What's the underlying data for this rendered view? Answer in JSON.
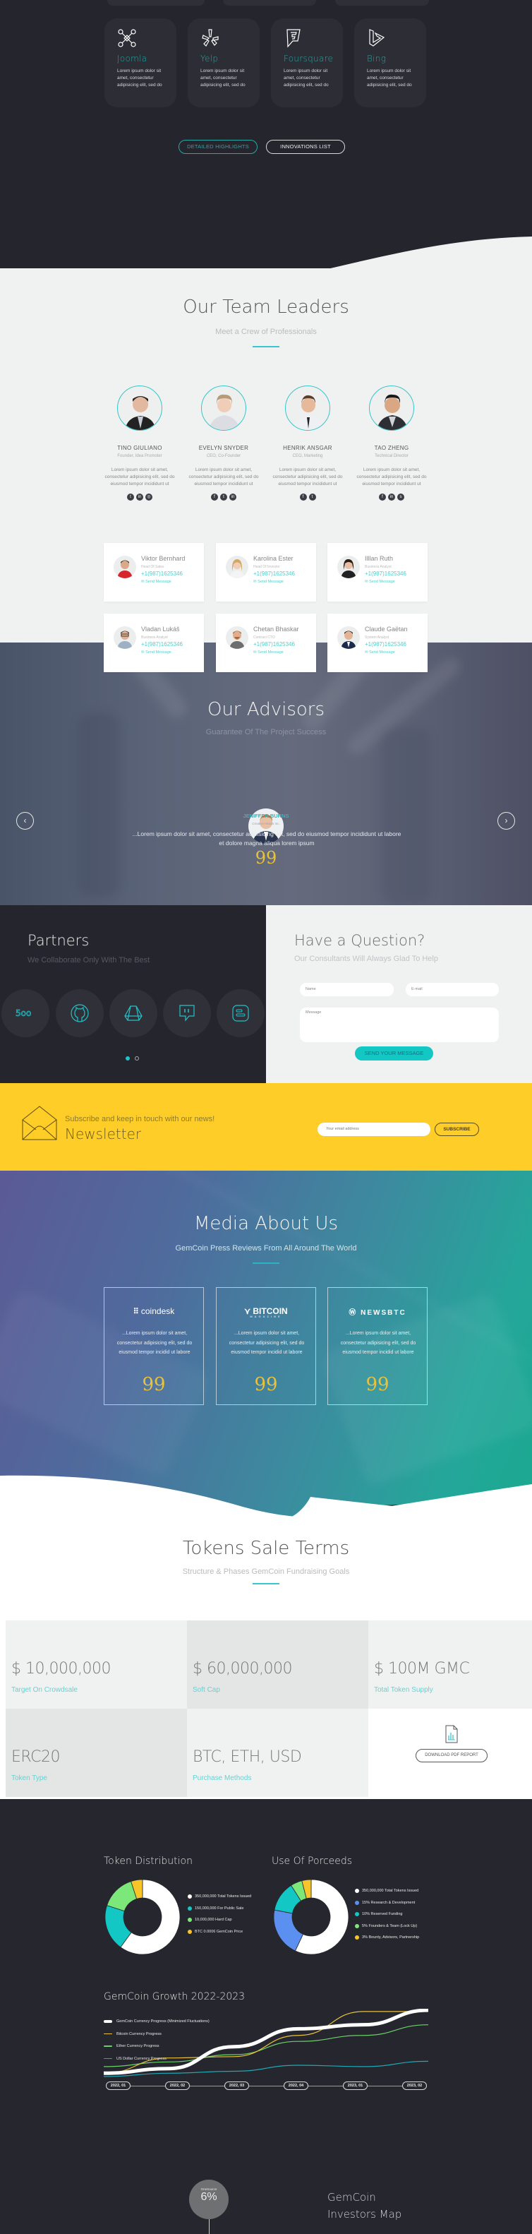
{
  "features": {
    "cards": [
      {
        "icon": "joomla-icon",
        "title": "Joomla",
        "text": "Lorem ipsum dolor sit amet, consectetur adipisicing elit, sed do"
      },
      {
        "icon": "yelp-icon",
        "title": "Yelp",
        "text": "Lorem ipsum dolor sit amet, consectetur adipisicing elit, sed do"
      },
      {
        "icon": "foursquare-icon",
        "title": "Foursquare",
        "text": "Lorem ipsum dolor sit amet, consectetur adipisicing elit, sed do"
      },
      {
        "icon": "bing-icon",
        "title": "Bing",
        "text": "Lorem ipsum dolor sit amet, consectetur adipisicing elit, sed do"
      }
    ],
    "buttons": {
      "highlights": "DETAILED HIGHLIGHTS",
      "innovations": "INNOVATIONS LIST"
    }
  },
  "team": {
    "title": "Our Team Leaders",
    "subtitle": "Meet a Crew of Professionals",
    "leaders": [
      {
        "name": "TINO GIULIANO",
        "role": "Founder, Idea Promoter",
        "desc": "Lorem ipsum dolor sit amet, consectetur adipisicing elit, sed do eiusmod tempor incididunt ut",
        "socials": [
          "twitter-icon",
          "linkedin-icon",
          "instagram-icon"
        ]
      },
      {
        "name": "EVELYN SNYDER",
        "role": "CEO, Co-Founder",
        "desc": "Lorem ipsum dolor sit amet, consectetur adipisicing elit, sed do eiusmod tempor incididunt ut",
        "socials": [
          "facebook-icon",
          "twitter-icon",
          "linkedin-icon"
        ]
      },
      {
        "name": "HENRIK ANSGAR",
        "role": "CEO, Marketing",
        "desc": "Lorem ipsum dolor sit amet, consectetur adipisicing elit, sed do eiusmod tempor incididunt ut",
        "socials": [
          "facebook-icon",
          "twitter-icon"
        ]
      },
      {
        "name": "TAO ZHENG",
        "role": "Technical Director",
        "desc": "Lorem ipsum dolor sit amet, consectetur adipisicing elit, sed do eiusmod tempor incididunt ut",
        "socials": [
          "facebook-icon",
          "linkedin-icon",
          "skype-icon"
        ]
      }
    ],
    "members": [
      {
        "name": "Viktor Bernhard",
        "role": "Head Of Sales",
        "phone": "+1(987)1625346",
        "action": "Send Message"
      },
      {
        "name": "Karolina Ester",
        "role": "Head Of Investor",
        "phone": "+1(987)1625346",
        "action": "Send Message"
      },
      {
        "name": "Illlan Ruth",
        "role": "Business Analyst",
        "phone": "+1(987)1625346",
        "action": "Send Message"
      },
      {
        "name": "Vladan Lukáš",
        "role": "Business Analyst",
        "phone": "+1(987)1625346",
        "action": "Send Message"
      },
      {
        "name": "Chetan Bhaskar",
        "role": "Contract CTO",
        "phone": "+1(987)1625346",
        "action": "Send Message"
      },
      {
        "name": "Claude Gaëtan",
        "role": "System Analyst",
        "phone": "+1(987)1625346",
        "action": "Send Message"
      }
    ]
  },
  "advisors": {
    "title": "Our Advisors",
    "subtitle": "Guarantee Of The Project Success",
    "name": "JENIFFER BURNS",
    "company": "Creative Heads Inc.",
    "quote": "...Lorem ipsum dolor sit amet, consectetur adipisicing elit, sed do eiusmod tempor incididunt ut labore et dolore magna aliqua lorem ipsum",
    "quote_mark": "99"
  },
  "partners": {
    "title": "Partners",
    "subtitle": "We Collaborate Only With The Best",
    "logos": [
      "500px-icon",
      "github-icon",
      "google-drive-icon",
      "twitch-icon",
      "blogger-icon"
    ],
    "active_page": 1,
    "pages": 2
  },
  "question": {
    "title": "Have a Question?",
    "subtitle": "Our Consultants Will Always Glad To Help",
    "name_placeholder": "Name",
    "email_placeholder": "E-mail",
    "message_placeholder": "Message",
    "submit": "SEND YOUR MESSAGE"
  },
  "newsletter": {
    "tagline": "Subscribe and keep in touch with our news!",
    "title": "Newsletter",
    "email_placeholder": "Your email address",
    "button": "SUBSCRIBE"
  },
  "media": {
    "title": "Media About Us",
    "subtitle": "GemCoin Press Reviews From All Around The World",
    "cards": [
      {
        "logo": "coindesk",
        "text": "...Lorem ipsum dolor sit amet, consectetur adipisicing elit, sed do eiusmod tempor incidid ut labore"
      },
      {
        "logo": "BITCOIN",
        "logo_sub": "MAGAZINE",
        "text": "...Lorem ipsum dolor sit amet, consectetur adipisicing elit, sed do eiusmod tempor incidid ut labore"
      },
      {
        "logo": "NEWSBTC",
        "text": "...Lorem ipsum dolor sit amet, consectetur adipisicing elit, sed do eiusmod tempor incidid ut labore"
      }
    ],
    "quote_mark": "99"
  },
  "tokens": {
    "title": "Tokens Sale Terms",
    "subtitle": "Structure & Phases GemCoin Fundraising Goals",
    "cells": [
      {
        "value": "$ 10,000,000",
        "label": "Target On Crowdsale"
      },
      {
        "value": "$ 60,000,000",
        "label": "Soft Cap"
      },
      {
        "value": "$ 100M GMC",
        "label": "Total Token Supply"
      },
      {
        "value": "ERC20",
        "label": "Token Type"
      },
      {
        "value": "BTC, ETH, USD",
        "label": "Purchase Methods"
      }
    ],
    "download": "DOWNLOAD PDF REPORT"
  },
  "colors": {
    "accent": "#3bc5cf",
    "dark": "#26272e",
    "yellow": "#fecd27",
    "white": "#ffffff",
    "cyan": "#13c7c4",
    "green": "#7de87a",
    "gold": "#f7c52a",
    "blue": "#5b8ff0"
  },
  "chart_data": [
    {
      "type": "pie",
      "title": "Token Distribution",
      "labels": [
        "350,000,000 Total Tokens Issued",
        "150,000,000 For Public Sale",
        "10,000,000 Hard Cap",
        "BTC 0.0006 GemCoin Price"
      ],
      "values": [
        60,
        20,
        15,
        5
      ],
      "colors": [
        "#ffffff",
        "#13c7c4",
        "#7de87a",
        "#f7c52a"
      ],
      "legend": "right"
    },
    {
      "type": "pie",
      "title": "Use Of Porceeds",
      "labels": [
        "350,000,000 Total Tokens Issued",
        "15% Research & Development",
        "10% Reserved Funding",
        "5% Founders & Team (Lock Up)",
        "3% Bounty, Advisors, Partnership"
      ],
      "values": [
        57,
        21,
        13,
        5,
        4
      ],
      "colors": [
        "#ffffff",
        "#5b8ff0",
        "#13c7c4",
        "#7de87a",
        "#f7c52a"
      ],
      "legend": "right"
    },
    {
      "type": "line",
      "title": "GemCoin Growth 2022-2023",
      "x": [
        "2022, 01",
        "2022, 02",
        "2022, 03",
        "2022, 04",
        "2023, 01",
        "2023, 02"
      ],
      "ylim": [
        0,
        100
      ],
      "legend": "top-left",
      "series": [
        {
          "name": "GemCoin Currency Progress (Minimized Fluctuations)",
          "color": "#ffffff",
          "values": [
            5,
            12,
            45,
            72,
            78,
            100
          ]
        },
        {
          "name": "Bitcoin Currency Progress",
          "color": "#e8c23b",
          "values": [
            5,
            28,
            30,
            62,
            98,
            98
          ]
        },
        {
          "name": "Ether Currency Progress",
          "color": "#6ccf6a",
          "values": [
            15,
            22,
            33,
            53,
            62,
            78
          ]
        },
        {
          "name": "US Dollar Currency Progress",
          "color": "#1ea7b4",
          "values": [
            0,
            5,
            8,
            17,
            15,
            23
          ]
        }
      ]
    }
  ],
  "investors": {
    "bubble_label": "OneSource",
    "bubble_value": "6%",
    "title_line1": "GemCoin",
    "title_line2": "Investors Map"
  }
}
